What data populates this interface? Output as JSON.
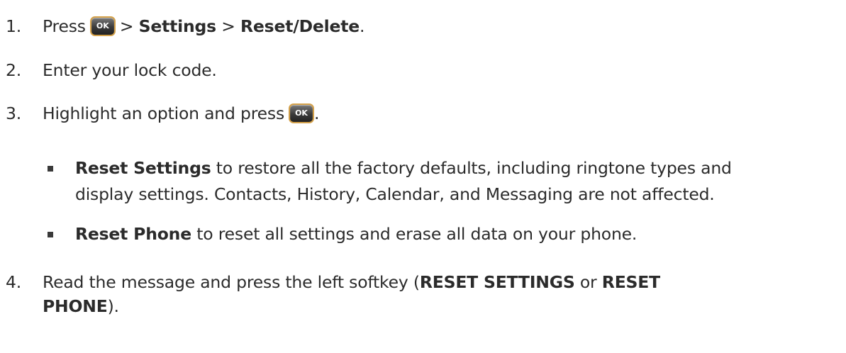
{
  "steps": [
    {
      "num": "1.",
      "press": "Press",
      "sep1": ">",
      "settings": "Settings",
      "sep2": ">",
      "reset_delete": "Reset/Delete",
      "end": ".",
      "ok_label": "OK"
    },
    {
      "num": "2.",
      "text": "Enter your lock code."
    },
    {
      "num": "3.",
      "text": "Highlight an option and press",
      "end": ".",
      "ok_label": "OK"
    },
    {
      "num": "4.",
      "line1_a": "Read the message and press the left softkey (",
      "reset_settings": "RESET SETTINGS",
      "or": "or",
      "reset": "RESET",
      "phone": "PHONE",
      "line2_end": ")."
    }
  ],
  "bullets": [
    {
      "bold": "Reset Settings",
      "line1": "to restore all the factory defaults, including ringtone types and",
      "line2": "display settings. Contacts, History, Calendar, and Messaging are not affected."
    },
    {
      "bold": "Reset Phone",
      "line1": "to reset all settings and erase all data on your phone."
    }
  ]
}
